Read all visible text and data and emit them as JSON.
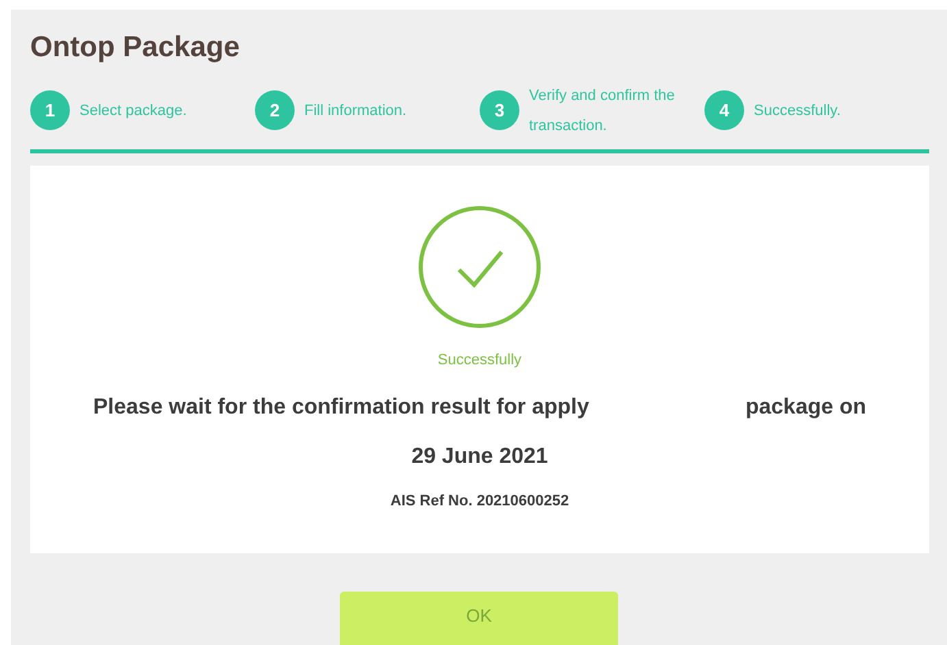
{
  "title": "Ontop Package",
  "steps": [
    {
      "number": "1",
      "label": "Select package."
    },
    {
      "number": "2",
      "label": "Fill information."
    },
    {
      "number": "3",
      "label": "Verify and confirm the transaction."
    },
    {
      "number": "4",
      "label": "Successfully."
    }
  ],
  "result": {
    "status": "Successfully",
    "message_start": "Please wait for the confirmation result for apply",
    "message_end": "package on",
    "date": "29 June 2021",
    "reference": "AIS Ref No. 20210600252"
  },
  "ok_button": "OK"
}
